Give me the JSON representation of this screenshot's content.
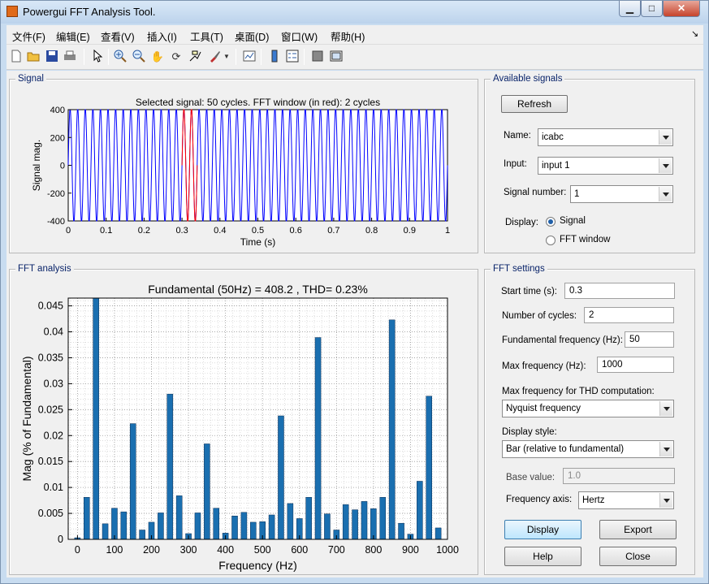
{
  "window": {
    "title": "Powergui FFT Analysis Tool.",
    "min": "▁",
    "max": "□",
    "close": "✕"
  },
  "menu": [
    "文件(F)",
    "编辑(E)",
    "查看(V)",
    "插入(I)",
    "工具(T)",
    "桌面(D)",
    "窗口(W)",
    "帮助(H)"
  ],
  "menu_dock": "↘",
  "toolbar": [
    "new-file-icon",
    "open-folder-icon",
    "save-icon",
    "print-icon",
    "pointer-icon",
    "zoom-in-icon",
    "zoom-out-icon",
    "pan-hand-icon",
    "rotate-3d-icon",
    "data-cursor-icon",
    "brush-icon",
    "brush-menu-icon",
    "link-plot-icon",
    "insert-colorbar-icon",
    "insert-legend-icon",
    "hide-plot-tools-icon",
    "show-plot-tools-icon"
  ],
  "signal_panel": {
    "label": "Signal",
    "chart_data": {
      "type": "line",
      "title": "Selected signal: 50 cycles. FFT window (in red): 2 cycles",
      "xlabel": "Time (s)",
      "ylabel": "Signal mag.",
      "xlim": [
        0,
        1
      ],
      "ylim": [
        -400,
        400
      ],
      "xticks": [
        "0",
        "0.1",
        "0.2",
        "0.3",
        "0.4",
        "0.5",
        "0.6",
        "0.7",
        "0.8",
        "0.9",
        "1"
      ],
      "yticks": [
        "400",
        "200",
        "0",
        "-200",
        "-400"
      ],
      "cycles": 50,
      "amplitude": 408.2,
      "frequency_hz": 50,
      "fft_window": [
        0.3,
        0.34
      ],
      "colors": {
        "signal": "#0000ff",
        "window": "#ff0000"
      }
    }
  },
  "available_signals": {
    "label": "Available signals",
    "refresh": "Refresh",
    "name_label": "Name:",
    "name_value": "icabc",
    "input_label": "Input:",
    "input_value": "input 1",
    "signal_number_label": "Signal number:",
    "signal_number_value": "1",
    "display_label": "Display:",
    "display_signal": "Signal",
    "display_fft": "FFT window"
  },
  "fft_panel": {
    "label": "FFT analysis",
    "chart_data": {
      "type": "bar",
      "title": "Fundamental (50Hz) = 408.2 , THD= 0.23%",
      "xlabel": "Frequency (Hz)",
      "ylabel": "Mag (% of Fundamental)",
      "xlim": [
        -25,
        1000
      ],
      "ylim": [
        0,
        0.0465
      ],
      "xticks": [
        "0",
        "100",
        "200",
        "300",
        "400",
        "500",
        "600",
        "700",
        "800",
        "900",
        "1000"
      ],
      "yticks": [
        "0",
        "0.005",
        "0.01",
        "0.015",
        "0.02",
        "0.025",
        "0.03",
        "0.035",
        "0.04",
        "0.045"
      ],
      "bar_color": "#1a6fb0",
      "x": [
        0,
        25,
        50,
        75,
        100,
        125,
        150,
        175,
        200,
        225,
        250,
        275,
        300,
        325,
        350,
        375,
        400,
        425,
        450,
        475,
        500,
        525,
        550,
        575,
        600,
        625,
        650,
        675,
        700,
        725,
        750,
        775,
        800,
        825,
        850,
        875,
        900,
        925,
        950,
        975
      ],
      "values": [
        0.0003,
        0.0081,
        0.0465,
        0.003,
        0.006,
        0.0053,
        0.0223,
        0.0018,
        0.0033,
        0.0051,
        0.028,
        0.0084,
        0.0011,
        0.0051,
        0.0184,
        0.006,
        0.0012,
        0.0045,
        0.0052,
        0.0033,
        0.0034,
        0.0047,
        0.0238,
        0.0069,
        0.004,
        0.0081,
        0.0389,
        0.0049,
        0.0018,
        0.0067,
        0.0057,
        0.0073,
        0.0059,
        0.0081,
        0.0423,
        0.0031,
        0.001,
        0.0112,
        0.0276,
        0.0022
      ]
    }
  },
  "fft_settings": {
    "label": "FFT settings",
    "start_time_label": "Start time (s):",
    "start_time": "0.3",
    "cycles_label": "Number of cycles:",
    "cycles": "2",
    "fund_freq_label": "Fundamental frequency (Hz):",
    "fund_freq": "50",
    "max_freq_label": "Max frequency (Hz):",
    "max_freq": "1000",
    "thd_label": "Max frequency for THD computation:",
    "thd_value": "Nyquist frequency",
    "style_label": "Display style:",
    "style_value": "Bar (relative to fundamental)",
    "base_label": "Base value:",
    "base_value": "1.0",
    "axis_label": "Frequency axis:",
    "axis_value": "Hertz",
    "display_btn": "Display",
    "export_btn": "Export",
    "help_btn": "Help",
    "close_btn": "Close"
  }
}
